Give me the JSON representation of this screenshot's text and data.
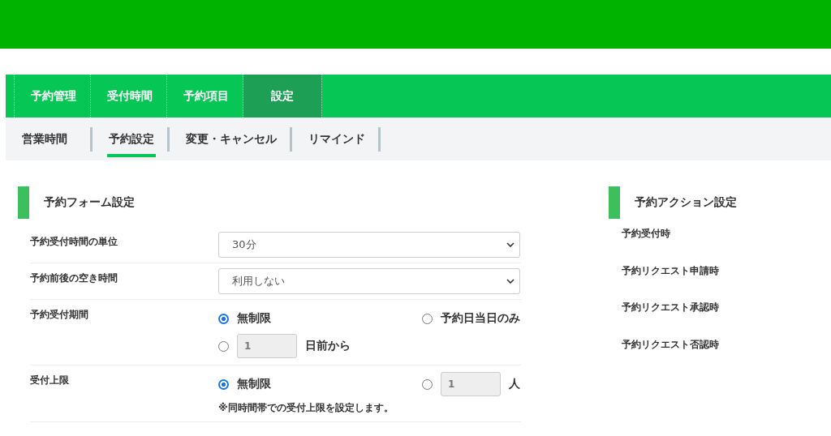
{
  "tabs": [
    {
      "label": "予約管理",
      "selected": false
    },
    {
      "label": "受付時間",
      "selected": false
    },
    {
      "label": "予約項目",
      "selected": false
    },
    {
      "label": "設定",
      "selected": true
    }
  ],
  "subtabs": [
    {
      "label": "営業時間",
      "selected": false
    },
    {
      "label": "予約設定",
      "selected": true
    },
    {
      "label": "変更・キャンセル",
      "selected": false
    },
    {
      "label": "リマインド",
      "selected": false
    }
  ],
  "form": {
    "title": "予約フォーム設定",
    "rows": [
      {
        "kind": "select",
        "label": "予約受付時間の単位",
        "value": "30分"
      },
      {
        "kind": "select",
        "label": "予約前後の空き時間",
        "value": "利用しない"
      },
      {
        "kind": "radio",
        "label": "予約受付期間",
        "lines": [
          [
            {
              "label": "無制限",
              "selected": true
            },
            {
              "label": "予約日当日のみ",
              "selected": false
            }
          ],
          [
            {
              "input": "1",
              "suffix": "日前から",
              "selected": false
            }
          ]
        ]
      },
      {
        "kind": "radio",
        "label": "受付上限",
        "lines": [
          [
            {
              "label": "無制限",
              "selected": true
            },
            {
              "input": "1",
              "suffix": "人",
              "selected": false
            }
          ]
        ],
        "note": "※同時間帯での受付上限を設定します。"
      }
    ]
  },
  "actions": {
    "title": "予約アクション設定",
    "items": [
      "予約受付時",
      "予約リクエスト申請時",
      "予約リクエスト承認時",
      "予約リクエスト否認時"
    ]
  }
}
